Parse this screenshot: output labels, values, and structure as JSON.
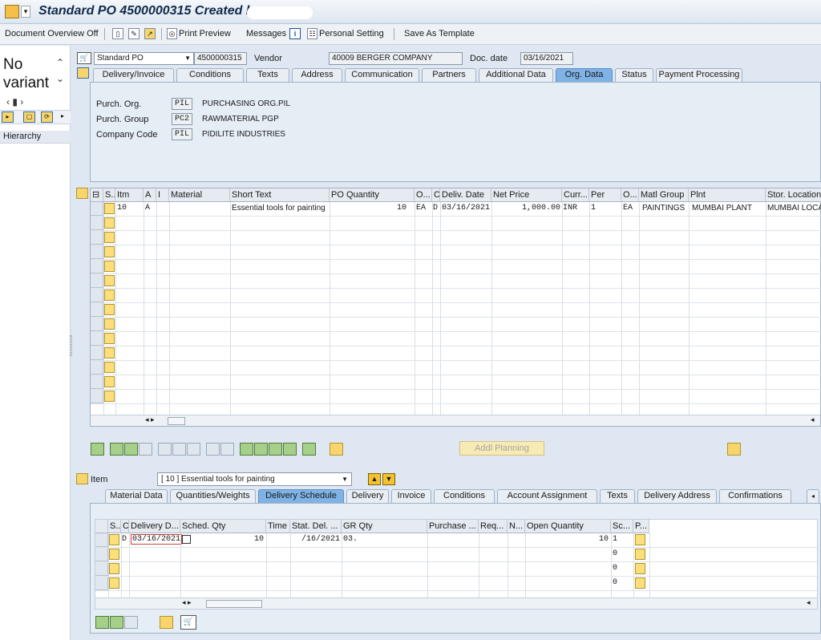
{
  "window": {
    "title": "Standard PO 4500000315 Created by"
  },
  "toolbar": {
    "doc_overview": "Document Overview Off",
    "print_preview": "Print Preview",
    "messages": "Messages",
    "personal_setting": "Personal Setting",
    "save_template": "Save As Template"
  },
  "left": {
    "no_variant": "No variant",
    "hierarchy": "Hierarchy"
  },
  "header": {
    "doc_type": "Standard PO",
    "po_number": "4500000315",
    "vendor_label": "Vendor",
    "vendor": "40009 BERGER COMPANY",
    "doc_date_label": "Doc. date",
    "doc_date": "03/16/2021",
    "tabs": [
      "Delivery/Invoice",
      "Conditions",
      "Texts",
      "Address",
      "Communication",
      "Partners",
      "Additional Data",
      "Org. Data",
      "Status",
      "Payment Processing"
    ],
    "active_tab": "Org. Data"
  },
  "org": {
    "purch_org_label": "Purch. Org.",
    "purch_org_code": "PIL",
    "purch_org_name": "PURCHASING ORG.PIL",
    "purch_group_label": "Purch. Group",
    "purch_group_code": "PC2",
    "purch_group_name": "RAWMATERIAL PGP",
    "company_label": "Company Code",
    "company_code": "PIL",
    "company_name": "PIDILITE INDUSTRIES"
  },
  "items": {
    "columns": [
      "S..",
      "Itm",
      "A",
      "I",
      "Material",
      "Short Text",
      "PO Quantity",
      "O...",
      "C",
      "Deliv. Date",
      "Net Price",
      "Curr...",
      "Per",
      "O...",
      "Matl Group",
      "Plnt",
      "Stor. Location"
    ],
    "rows": [
      {
        "itm": "10",
        "a": "A",
        "i": "",
        "material": "",
        "short_text": "Essential tools for painting",
        "qty": "10",
        "uom": "EA",
        "c": "D",
        "deliv": "03/16/2021",
        "price": "1,000.00",
        "curr": "INR",
        "per": "1",
        "opu": "EA",
        "matl_group": "PAINTINGS",
        "plant": "MUMBAI PLANT",
        "stor": "MUMBAI LOCA"
      }
    ]
  },
  "actions": {
    "addl_planning": "Addl Planning"
  },
  "item_detail": {
    "label": "Item",
    "selected": "[ 10 ] Essential tools for painting",
    "tabs": [
      "Material Data",
      "Quantities/Weights",
      "Delivery Schedule",
      "Delivery",
      "Invoice",
      "Conditions",
      "Account Assignment",
      "Texts",
      "Delivery Address",
      "Confirmations"
    ],
    "active_tab": "Delivery Schedule"
  },
  "schedule": {
    "columns": [
      "S...",
      "C",
      "Delivery D...",
      "Sched. Qty",
      "Time",
      "Stat. Del. ...",
      "GR Qty",
      "Purchase ...",
      "Req...",
      "N...",
      "Open Quantity",
      "Sc...",
      "P..."
    ],
    "rows": [
      {
        "c": "D",
        "date": "03/16/2021",
        "qty": "10",
        "time": "",
        "stat": "/16/2021",
        "gr": "03.",
        "open": "10",
        "sc": "1"
      },
      {
        "c": "",
        "date": "",
        "qty": "",
        "time": "",
        "stat": "",
        "gr": "",
        "open": "",
        "sc": "0"
      },
      {
        "c": "",
        "date": "",
        "qty": "",
        "time": "",
        "stat": "",
        "gr": "",
        "open": "",
        "sc": "0"
      },
      {
        "c": "",
        "date": "",
        "qty": "",
        "time": "",
        "stat": "",
        "gr": "",
        "open": "",
        "sc": "0"
      }
    ]
  }
}
